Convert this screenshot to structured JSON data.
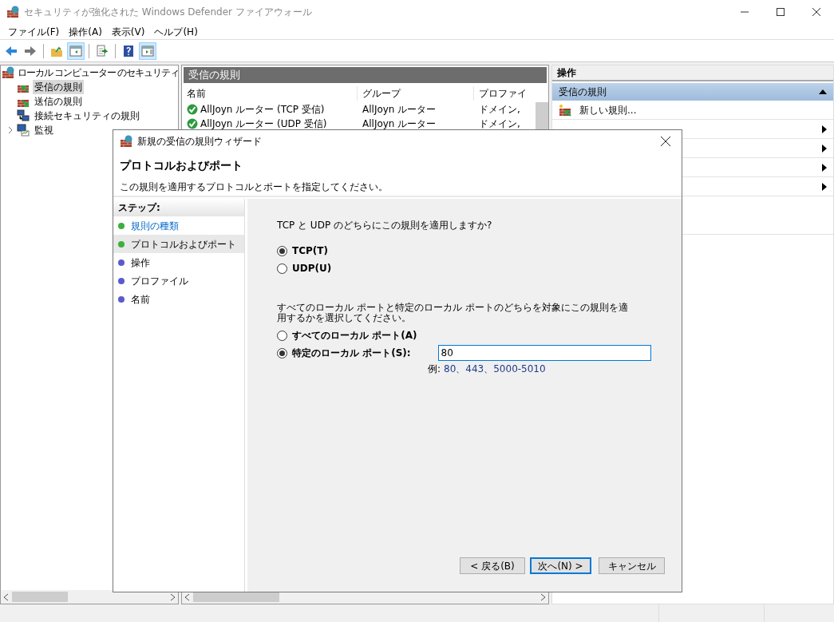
{
  "window": {
    "title": "セキュリティが強化された Windows Defender ファイアウォール"
  },
  "menu": [
    "ファイル(F)",
    "操作(A)",
    "表示(V)",
    "ヘルプ(H)"
  ],
  "toolbar": [
    {
      "kind": "back",
      "pressed": false
    },
    {
      "kind": "forward",
      "pressed": false
    },
    {
      "kind": "separator"
    },
    {
      "kind": "up",
      "pressed": false
    },
    {
      "kind": "tree",
      "pressed": true
    },
    {
      "kind": "separator"
    },
    {
      "kind": "export",
      "pressed": false
    },
    {
      "kind": "separator"
    },
    {
      "kind": "help",
      "pressed": false
    },
    {
      "kind": "actions",
      "pressed": true
    }
  ],
  "tree": {
    "label": "ローカル コンピューター のセキュリティ",
    "children": [
      {
        "label": "受信の規則",
        "kind": "inbound",
        "selected": true,
        "collapsed": false
      },
      {
        "label": "送信の規則",
        "kind": "outbound",
        "selected": false,
        "collapsed": false
      },
      {
        "label": "接続セキュリティの規則",
        "kind": "connection",
        "selected": false,
        "collapsed": false
      },
      {
        "label": "監視",
        "kind": "monitor",
        "selected": false,
        "collapsed": true
      }
    ]
  },
  "rules": {
    "title": "受信の規則",
    "columns": [
      "名前",
      "グループ",
      "プロファイ"
    ],
    "rows": [
      {
        "cells": [
          "AllJoyn ルーター (TCP 受信)",
          "AllJoyn ルーター",
          "ドメイン,"
        ],
        "enabled": true
      },
      {
        "cells": [
          "AllJoyn ルーター (UDP 受信)",
          "AllJoyn ルーター",
          "ドメイン,"
        ],
        "enabled": true
      }
    ]
  },
  "actions": {
    "title": "操作",
    "section": {
      "title": "受信の規則",
      "expanded": true
    },
    "items": [
      {
        "kind": "new",
        "label": "新しい規則..."
      },
      {
        "kind": "submenu"
      },
      {
        "kind": "submenu"
      },
      {
        "kind": "submenu"
      },
      {
        "kind": "submenu"
      }
    ]
  },
  "dialog": {
    "title": "新規の受信の規則ウィザード",
    "heading": "プロトコルおよびポート",
    "subtitle": "この規則を適用するプロトコルとポートを指定してください。",
    "steps_title": "ステップ:",
    "steps": [
      {
        "label": "規則の種類",
        "completed": true,
        "selected": false
      },
      {
        "label": "プロトコルおよびポート",
        "completed": false,
        "selected": true
      },
      {
        "label": "操作",
        "completed": false,
        "selected": false
      },
      {
        "label": "プロファイル",
        "completed": false,
        "selected": false
      },
      {
        "label": "名前",
        "completed": false,
        "selected": false
      }
    ],
    "question": "TCP と UDP のどちらにこの規則を適用しますか?",
    "protocols": [
      {
        "label": "TCP(T)",
        "selected": true
      },
      {
        "label": "UDP(U)",
        "selected": false
      }
    ],
    "port_question": "すべてのローカル ポートと特定のローカル ポートのどちらを対象にこの規則を適用するかを選択してください。",
    "ports": [
      {
        "label": "すべてのローカル ポート(A)",
        "selected": false
      },
      {
        "label": "特定のローカル ポート(S):",
        "selected": true
      }
    ],
    "port_value": "80",
    "example_label": "例:",
    "example_value": "80、443、5000-5010",
    "buttons": [
      {
        "label": "< 戻る(B)",
        "default": false
      },
      {
        "label": "次へ(N) >",
        "default": true
      },
      {
        "label": "キャンセル",
        "default": false
      }
    ]
  }
}
